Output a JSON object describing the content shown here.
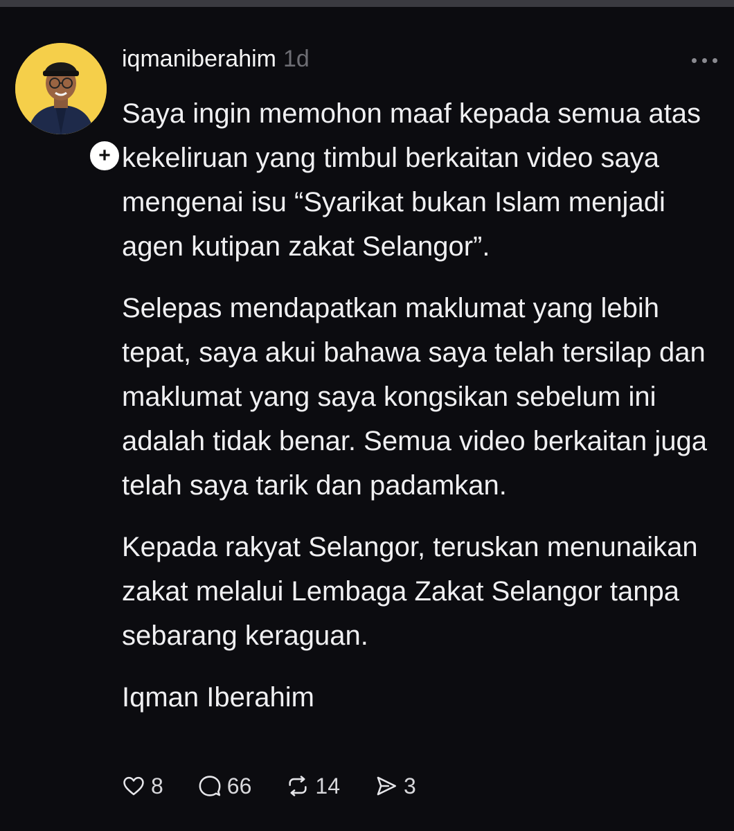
{
  "post": {
    "username": "iqmaniberahim",
    "timestamp": "1d",
    "follow_symbol": "+",
    "paragraphs": [
      "Saya ingin memohon maaf kepada semua atas kekeliruan yang timbul berkaitan video saya mengenai isu “Syarikat bukan Islam menjadi agen kutipan zakat Selangor”.",
      "Selepas mendapatkan maklumat yang lebih tepat, saya akui bahawa saya telah tersilap dan maklumat yang saya kongsikan sebelum ini adalah tidak benar. Semua video berkaitan juga telah saya tarik dan padamkan.",
      "Kepada rakyat Selangor, teruskan menunaikan zakat melalui Lembaga Zakat Selangor tanpa sebarang keraguan.",
      "Iqman Iberahim"
    ],
    "actions": {
      "likes": "8",
      "replies": "66",
      "reposts": "14",
      "shares": "3"
    }
  },
  "icons": {
    "like": "heart-icon",
    "reply": "comment-bubble-icon",
    "repost": "repost-icon",
    "share": "send-icon",
    "more": "more-options-icon",
    "follow": "plus-icon"
  },
  "colors": {
    "background": "#0c0c10",
    "text": "#f0f0f2",
    "muted": "#6e6e74",
    "avatar_bg": "#f5cf4a"
  }
}
